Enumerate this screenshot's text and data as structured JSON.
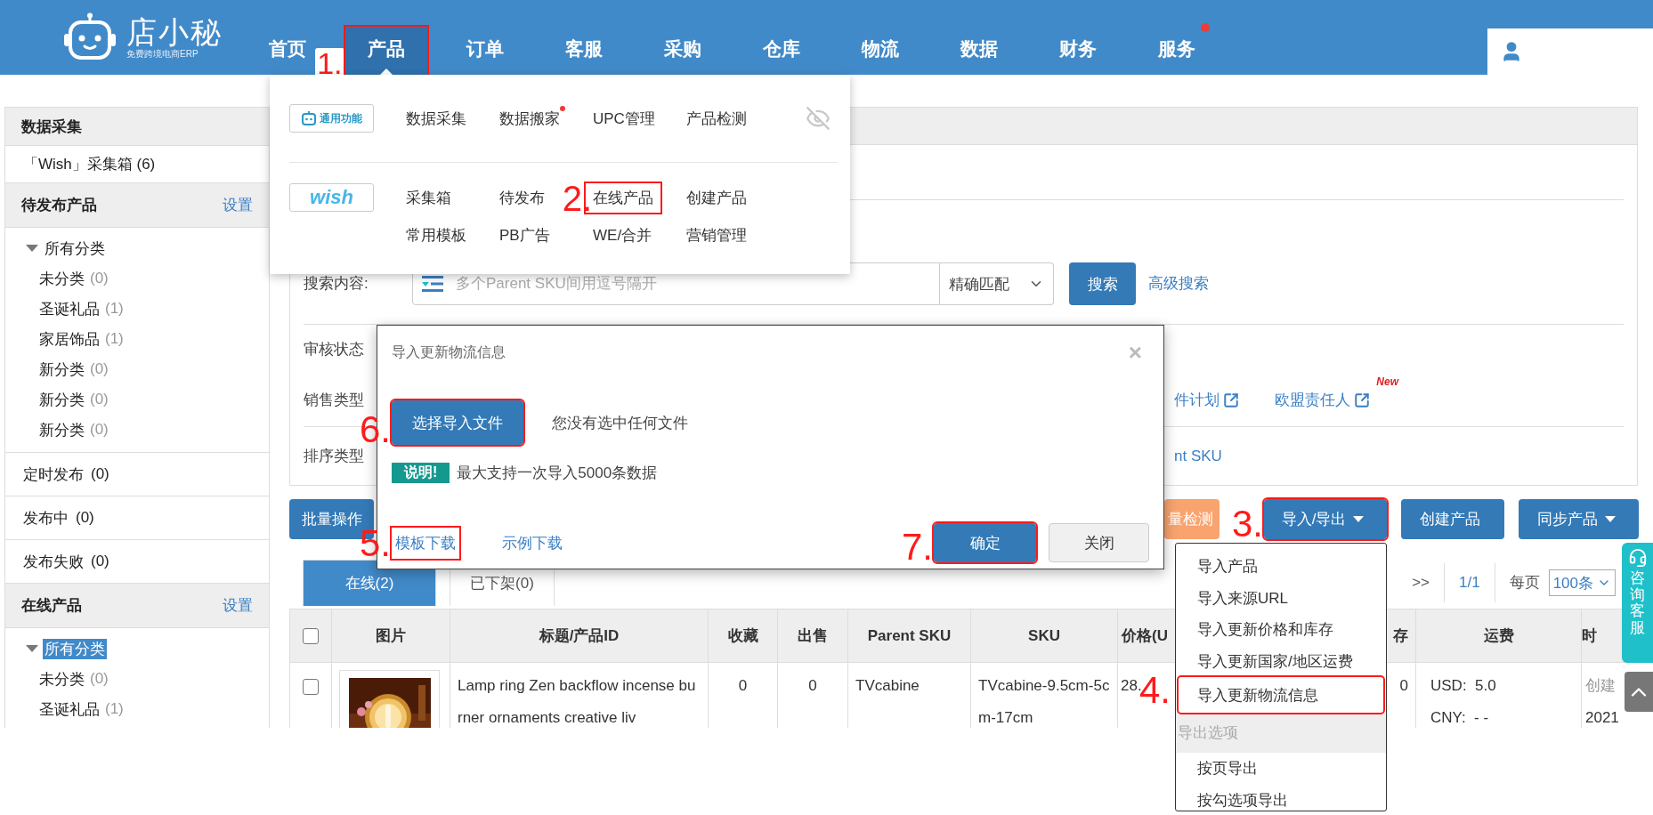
{
  "header": {
    "logo": {
      "name": "店小秘",
      "tagline": "免费跨境电商ERP"
    },
    "nav": [
      {
        "label": "首页",
        "selected": false
      },
      {
        "label": "产品",
        "selected": true,
        "step": "1."
      },
      {
        "label": "订单",
        "selected": false
      },
      {
        "label": "客服",
        "selected": false
      },
      {
        "label": "采购",
        "selected": false
      },
      {
        "label": "仓库",
        "selected": false
      },
      {
        "label": "物流",
        "selected": false
      },
      {
        "label": "数据",
        "selected": false
      },
      {
        "label": "财务",
        "selected": false
      },
      {
        "label": "服务",
        "selected": false,
        "dot": true
      }
    ]
  },
  "product_menu": {
    "groups": [
      {
        "kind": "general",
        "badge": "通用功能",
        "items": [
          {
            "label": "数据采集"
          },
          {
            "label": "数据搬家",
            "dot": true
          },
          {
            "label": "UPC管理"
          },
          {
            "label": "产品检测"
          }
        ]
      },
      {
        "kind": "wish",
        "badge": "wish",
        "items": [
          {
            "label": "采集箱"
          },
          {
            "label": "待发布"
          },
          {
            "label": "在线产品",
            "step": "2."
          },
          {
            "label": "创建产品"
          },
          {
            "label": "常用模板"
          },
          {
            "label": "PB广告"
          },
          {
            "label": "WE/合并"
          },
          {
            "label": "营销管理"
          }
        ]
      }
    ]
  },
  "sidebar": {
    "blocks": [
      {
        "kind": "header",
        "title": "数据采集"
      },
      {
        "kind": "link",
        "label": "「Wish」采集箱 (6)"
      },
      {
        "kind": "header",
        "title": "待发布产品",
        "action": "设置"
      },
      {
        "kind": "tree",
        "root": {
          "label": "所有分类",
          "selected": false,
          "expanded": true,
          "children": [
            {
              "label": "未分类",
              "count": "(0)",
              "selected": false
            },
            {
              "label": "圣诞礼品",
              "count": "(1)",
              "selected": false
            },
            {
              "label": "家居饰品",
              "count": "(1)",
              "selected": false
            },
            {
              "label": "新分类",
              "count": "(0)",
              "selected": false
            },
            {
              "label": "新分类",
              "count": "(0)",
              "selected": false
            },
            {
              "label": "新分类",
              "count": "(0)",
              "selected": false
            }
          ]
        }
      },
      {
        "kind": "link",
        "label": "定时发布",
        "count": "(0)"
      },
      {
        "kind": "link",
        "label": "发布中",
        "count": "(0)"
      },
      {
        "kind": "link",
        "label": "发布失败",
        "count": "(0)"
      },
      {
        "kind": "header",
        "title": "在线产品",
        "action": "设置"
      },
      {
        "kind": "tree",
        "root": {
          "label": "所有分类",
          "selected": true,
          "expanded": true,
          "children": [
            {
              "label": "未分类",
              "count": "(0)",
              "selected": false
            },
            {
              "label": "圣诞礼品",
              "count": "(1)",
              "selected": false
            }
          ]
        }
      }
    ]
  },
  "search": {
    "label": "搜索内容:",
    "placeholder": "多个Parent SKU间用逗号隔开",
    "match": "精确匹配",
    "button": "搜索",
    "advanced": "高级搜索"
  },
  "filters": [
    {
      "label": "审核状态"
    },
    {
      "label": "销售类型",
      "links": [
        {
          "label": "件计划",
          "external": true
        },
        {
          "label": "欧盟责任人",
          "external": true,
          "badge": "New"
        }
      ]
    },
    {
      "label": "排序类型",
      "links": [
        {
          "label": "nt SKU"
        }
      ]
    }
  ],
  "toolbar": {
    "batch": "批量操作",
    "buttons": [
      {
        "kind": "orange",
        "label": "量检测"
      },
      {
        "kind": "primary",
        "label": "导入/导出",
        "caret": true,
        "step": "3."
      },
      {
        "kind": "primary",
        "label": "创建产品"
      },
      {
        "kind": "primary",
        "label": "同步产品",
        "caret": true
      }
    ]
  },
  "tabs": [
    {
      "label": "在线(2)",
      "selected": true
    },
    {
      "label": "已下架(0)",
      "selected": false
    }
  ],
  "pagination": {
    "next": ">>",
    "page": "1/1",
    "per_page_label": "每页",
    "per_page": "100条"
  },
  "table": {
    "all_checked": false,
    "columns": [
      "图片",
      "标题/产品ID",
      "收藏",
      "出售",
      "Parent SKU",
      "SKU",
      "价格(U",
      "存",
      "运费",
      "时"
    ],
    "rows": [
      {
        "checked": false,
        "image": {
          "kind": "picture"
        },
        "title": "Lamp ring Zen backflow incense burner ornaments creative liv",
        "favorites": "0",
        "sold": "0",
        "parent_sku": "TVcabine",
        "sku": "TVcabine-9.5cm-5cm-17cm",
        "price": "28.",
        "stock": "0",
        "shipping": [
          "USD:  5.0",
          "CNY:  - -"
        ],
        "time": [
          "创建",
          "2021"
        ]
      }
    ]
  },
  "modal": {
    "title": "导入更新物流信息",
    "close": "×",
    "choose": {
      "label": "选择导入文件",
      "step": "6."
    },
    "file_status": "您没有选中任何文件",
    "note_badge": "说明!",
    "note": "最大支持一次导入5000条数据",
    "links": [
      {
        "label": "模板下载",
        "step": "5."
      },
      {
        "label": "示例下载"
      }
    ],
    "confirm": {
      "label": "确定",
      "step": "7."
    },
    "cancel": "关闭"
  },
  "export_menu": {
    "items": [
      {
        "kind": "item",
        "label": "导入产品"
      },
      {
        "kind": "item",
        "label": "导入来源URL"
      },
      {
        "kind": "item",
        "label": "导入更新价格和库存"
      },
      {
        "kind": "item",
        "label": "导入更新国家/地区运费"
      },
      {
        "kind": "item",
        "label": "导入更新物流信息",
        "step": "4."
      },
      {
        "kind": "header",
        "label": "导出选项"
      },
      {
        "kind": "item",
        "label": "按页导出"
      },
      {
        "kind": "item",
        "label": "按勾选项导出"
      }
    ]
  },
  "side_widget": {
    "label": "咨询客服"
  }
}
